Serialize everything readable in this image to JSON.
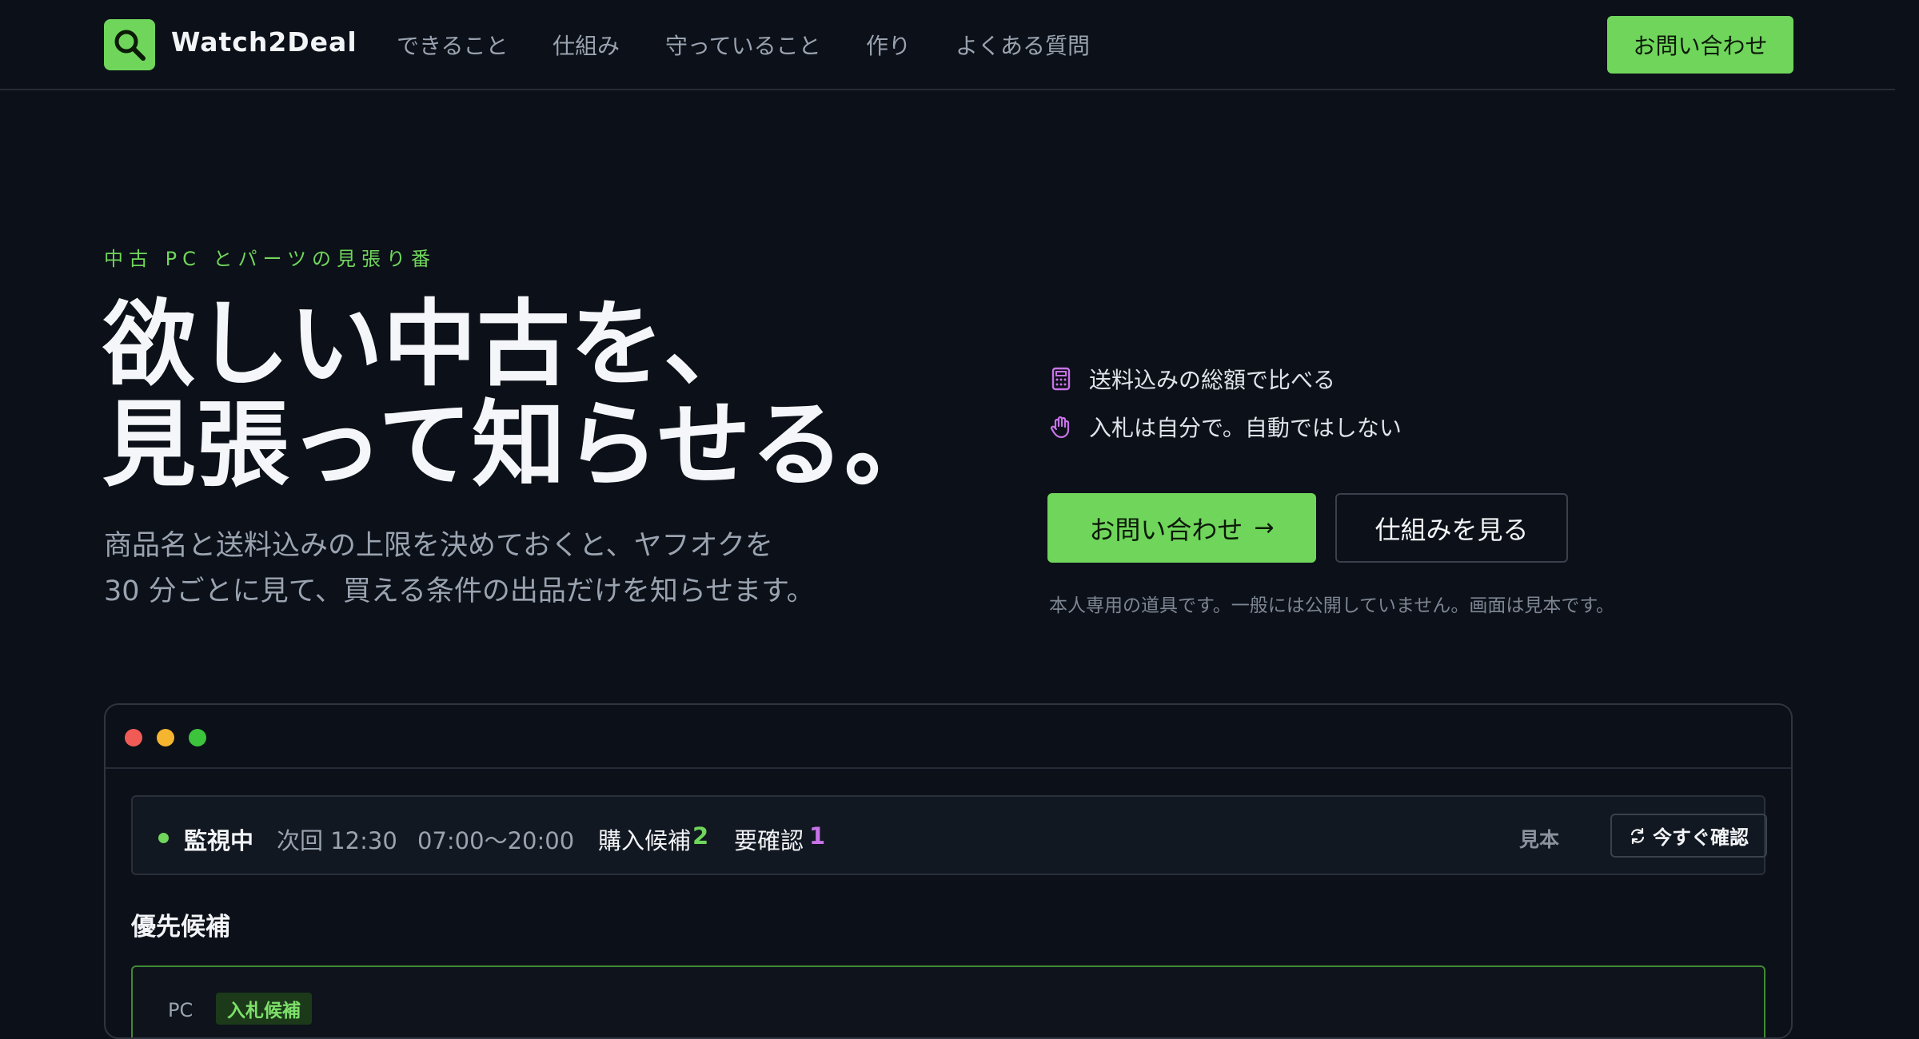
{
  "brand": {
    "name": "Watch2Deal",
    "logo_icon": "magnifier-icon",
    "accent": "#6fd65b"
  },
  "nav": {
    "items": [
      "できること",
      "仕組み",
      "守っていること",
      "作り",
      "よくある質問"
    ],
    "contact_label": "お問い合わせ"
  },
  "hero": {
    "eyebrow": "中古 PC とパーツの見張り番",
    "headline_line1": "欲しい中古を、",
    "headline_line2": "見張って知らせる。",
    "lead_line1": "商品名と送料込みの上限を決めておくと、ヤフオクを",
    "lead_line2": "30 分ごとに見て、買える条件の出品だけを知らせます。",
    "features": [
      {
        "icon": "calculator-icon",
        "text": "送料込みの総額で比べる"
      },
      {
        "icon": "hand-icon",
        "text": "入札は自分で。自動ではしない"
      }
    ],
    "primary_cta": "お問い合わせ",
    "primary_cta_arrow": "→",
    "secondary_cta": "仕組みを見る",
    "note": "本人専用の道具です。一般には公開していません。画面は見本です。"
  },
  "mockup": {
    "window_dots": [
      "#f15b55",
      "#f5b52e",
      "#3cc43c"
    ],
    "status": {
      "label": "監視中",
      "next": "次回 12:30",
      "hours": "07:00〜20:00",
      "candidates_label": "購入候補",
      "candidates_count": "2",
      "review_label": "要確認",
      "review_count": "1",
      "sample_label": "見本",
      "check_button": "今すぐ確認"
    },
    "section_title": "優先候補",
    "card": {
      "category": "PC",
      "badge": "入札候補"
    }
  }
}
